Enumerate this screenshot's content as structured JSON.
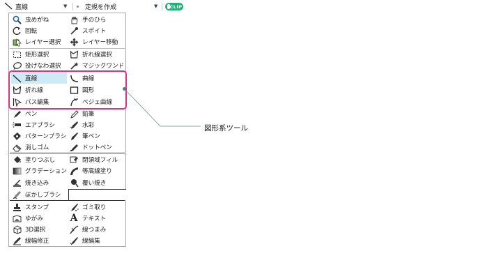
{
  "toolbar": {
    "tool_label": "直線",
    "ruler_label": "定規を作成",
    "badge": "CLIP"
  },
  "callout": "図形系ツール",
  "tools": [
    {
      "label": "虫めがね",
      "icon": "magnifier-icon"
    },
    {
      "label": "手のひら",
      "icon": "hand-icon"
    },
    {
      "label": "回転",
      "icon": "rotate-icon"
    },
    {
      "label": "スポイト",
      "icon": "eyedropper-icon"
    },
    {
      "label": "レイヤー選択",
      "icon": "layer-select-icon"
    },
    {
      "label": "レイヤー移動",
      "icon": "move-icon"
    },
    {
      "label": "矩形選択",
      "icon": "rect-select-icon"
    },
    {
      "label": "折れ線選択",
      "icon": "polyline-select-icon"
    },
    {
      "label": "投げなわ選択",
      "icon": "lasso-icon"
    },
    {
      "label": "マジックワンド",
      "icon": "magic-wand-icon"
    },
    {
      "label": "直線",
      "icon": "line-icon"
    },
    {
      "label": "曲線",
      "icon": "curve-icon"
    },
    {
      "label": "折れ線",
      "icon": "polyline-icon"
    },
    {
      "label": "図形",
      "icon": "shape-icon"
    },
    {
      "label": "パス編集",
      "icon": "path-edit-icon"
    },
    {
      "label": "ベジェ曲線",
      "icon": "bezier-icon"
    },
    {
      "label": "ペン",
      "icon": "pen-icon"
    },
    {
      "label": "鉛筆",
      "icon": "pencil-icon"
    },
    {
      "label": "エアブラシ",
      "icon": "airbrush-icon"
    },
    {
      "label": "水彩",
      "icon": "watercolor-icon"
    },
    {
      "label": "パターンブラシ",
      "icon": "pattern-brush-icon"
    },
    {
      "label": "筆ペン",
      "icon": "brush-pen-icon"
    },
    {
      "label": "消しゴム",
      "icon": "eraser-icon"
    },
    {
      "label": "ドットペン",
      "icon": "dot-pen-icon"
    },
    {
      "label": "塗りつぶし",
      "icon": "fill-icon"
    },
    {
      "label": "閉領域フィル",
      "icon": "closed-fill-icon"
    },
    {
      "label": "グラデーション",
      "icon": "gradient-icon"
    },
    {
      "label": "等高線塗り",
      "icon": "contour-fill-icon"
    },
    {
      "label": "焼き込み",
      "icon": "burn-icon"
    },
    {
      "label": "覆い焼き",
      "icon": "dodge-icon"
    },
    {
      "label": "ぼかしブラシ",
      "icon": "blur-brush-icon"
    },
    {
      "label": "スタンプ",
      "icon": "stamp-icon"
    },
    {
      "label": "ゴミ取り",
      "icon": "dust-remove-icon"
    },
    {
      "label": "ゆがみ",
      "icon": "warp-icon"
    },
    {
      "label": "テキスト",
      "icon": "text-icon"
    },
    {
      "label": "3D選択",
      "icon": "3d-select-icon"
    },
    {
      "label": "線つまみ",
      "icon": "line-pinch-icon"
    },
    {
      "label": "線幅修正",
      "icon": "line-width-icon"
    },
    {
      "label": "線編集",
      "icon": "line-edit-icon"
    }
  ]
}
